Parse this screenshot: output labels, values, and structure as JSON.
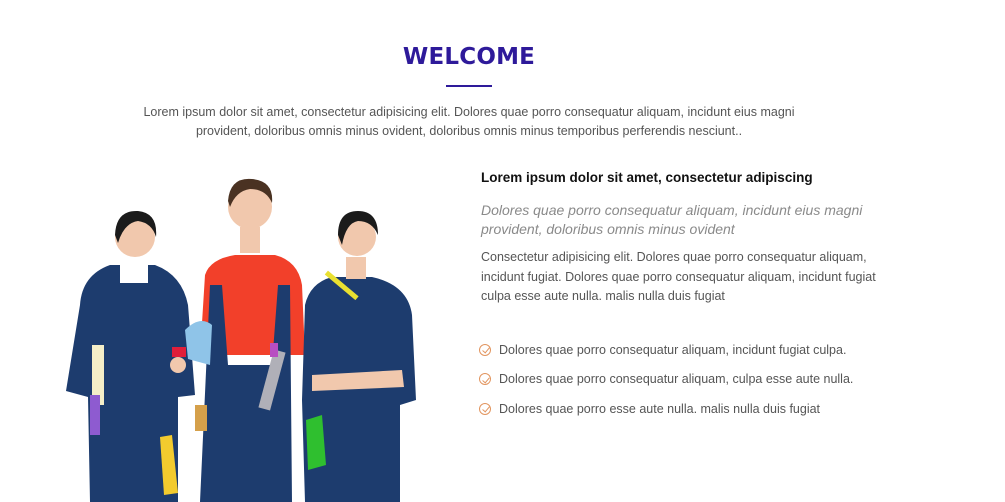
{
  "section": {
    "title": "WELCOME",
    "intro": "Lorem ipsum dolor sit amet, consectetur adipisicing elit. Dolores quae porro consequatur aliquam, incidunt eius magni provident, doloribus omnis minus ovident, doloribus omnis minus temporibus perferendis nesciunt.."
  },
  "content": {
    "heading": "Lorem ipsum dolor sit amet, consectetur adipiscing",
    "subheading": "Dolores quae porro consequatur aliquam, incidunt eius magni provident, doloribus omnis minus ovident",
    "paragraph": "Consectetur adipisicing elit. Dolores quae porro consequatur aliquam, incidunt fugiat. Dolores quae porro consequatur aliquam, incidunt fugiat culpa esse aute nulla. malis nulla duis fugiat",
    "bullets": [
      "Dolores quae porro consequatur aliquam, incidunt fugiat culpa.",
      "Dolores quae porro consequatur aliquam, culpa esse aute nulla.",
      "Dolores quae porro esse aute nulla. malis nulla duis fugiat"
    ]
  },
  "icons": {
    "bullet": "check-circle-icon"
  },
  "colors": {
    "accent": "#2e1a9a",
    "check": "#e2955f"
  }
}
